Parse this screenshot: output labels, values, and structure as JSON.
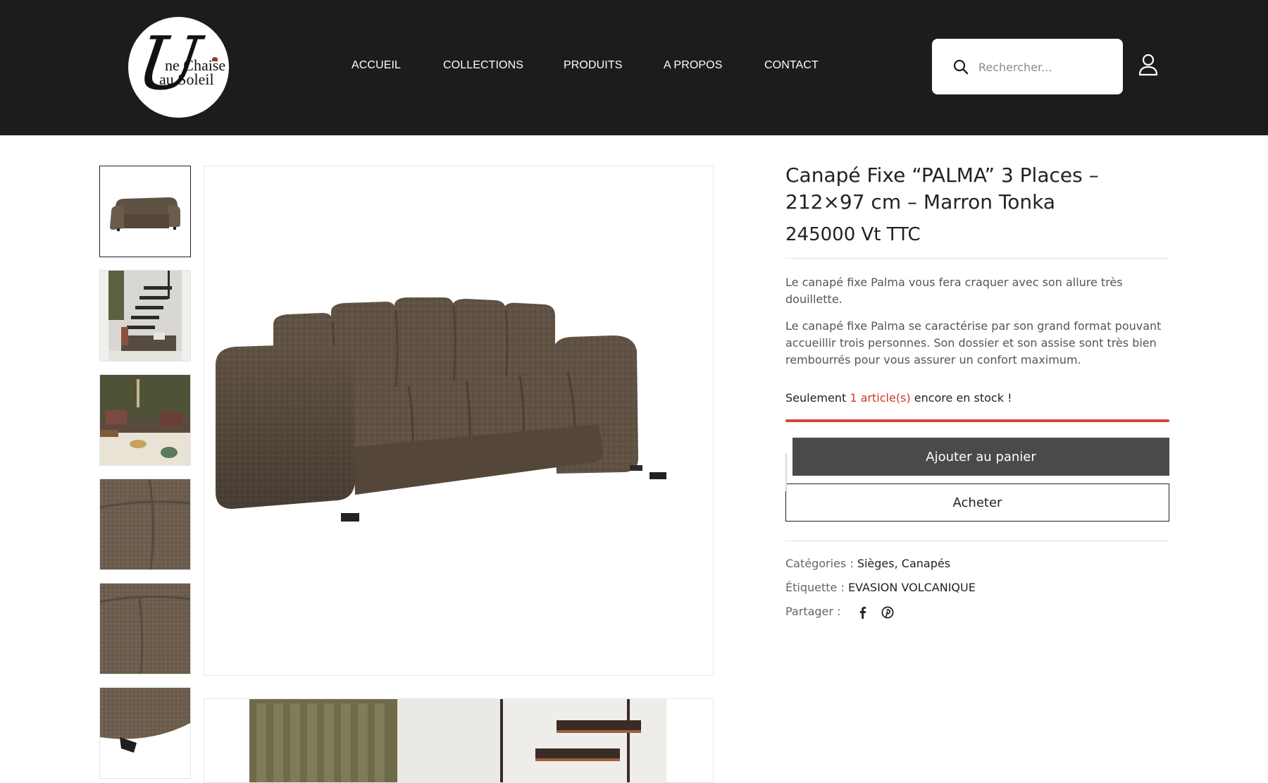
{
  "logo": {
    "big_letter": "U",
    "line1": "ne Chaise",
    "line2": "au Soleil"
  },
  "nav": [
    {
      "label": "ACCUEIL"
    },
    {
      "label": "COLLECTIONS"
    },
    {
      "label": "PRODUITS"
    },
    {
      "label": "A PROPOS"
    },
    {
      "label": "CONTACT"
    }
  ],
  "search": {
    "placeholder": "Rechercher...",
    "value": ""
  },
  "icons": {
    "search": "search-icon",
    "account": "user-icon",
    "facebook": "facebook-icon",
    "pinterest": "pinterest-icon"
  },
  "gallery": {
    "thumbnails": [
      {
        "name": "thumbnail-sofa-front"
      },
      {
        "name": "thumbnail-staircase-room"
      },
      {
        "name": "thumbnail-living-room"
      },
      {
        "name": "thumbnail-fabric-corner"
      },
      {
        "name": "thumbnail-fabric-seat"
      },
      {
        "name": "thumbnail-fabric-foot"
      }
    ]
  },
  "product": {
    "title": "Canapé Fixe “PALMA” 3 Places – 212×97 cm – Marron Tonka",
    "price": "245000 Vt TTC",
    "desc1": "Le canapé fixe Palma vous fera craquer avec son allure très douillette.",
    "desc2": "Le canapé fixe Palma se caractérise par son grand format pouvant accueillir trois personnes. Son dossier et son assise sont très bien rembourrés pour vous assurer un confort maximum.",
    "stock_prefix": "Seulement ",
    "stock_count": "1 article(s)",
    "stock_suffix": " encore en stock !",
    "stock_level": 0.05,
    "add_to_cart": "Ajouter au panier",
    "buy": "Acheter",
    "categories_label": "Catégories :",
    "category1": "Sièges",
    "category_sep": ", ",
    "category2": "Canapés",
    "tag_label": "Étiquette :",
    "tag": "EVASION VOLCANIQUE",
    "share_label": "Partager :"
  },
  "colors": {
    "header_bg": "#1c1c1c",
    "stock_red": "#d2342b",
    "cart_button": "#4a4a4a",
    "sofa": "#5f5143"
  }
}
